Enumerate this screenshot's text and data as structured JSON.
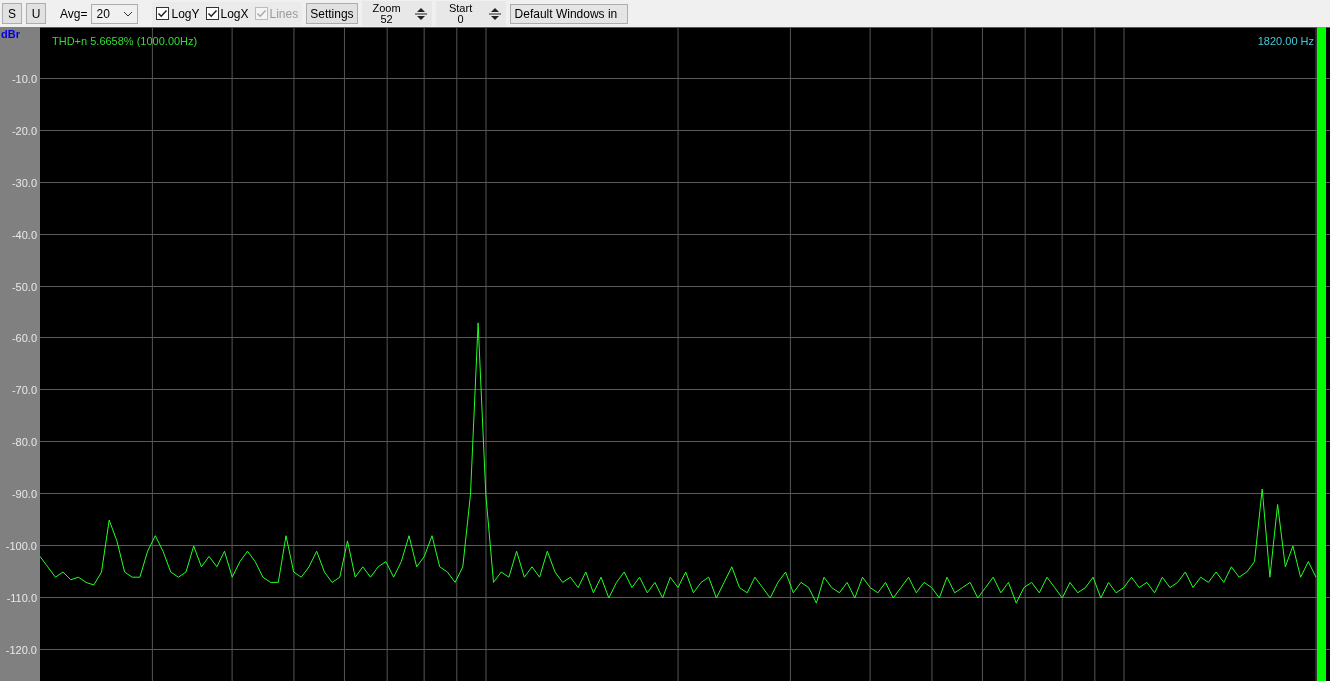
{
  "toolbar": {
    "buttons": [
      "S",
      "U"
    ],
    "avg": {
      "label": "Avg=",
      "value": "20"
    },
    "checkboxes": [
      {
        "label": "LogY",
        "checked": true,
        "disabled": false
      },
      {
        "label": "LogX",
        "checked": true,
        "disabled": false
      },
      {
        "label": "Lines",
        "checked": true,
        "disabled": true
      }
    ],
    "settings_button": "Settings",
    "spinners": [
      {
        "label": "Zoom",
        "value": "52"
      },
      {
        "label": "Start",
        "value": "0"
      }
    ],
    "device_select": {
      "value": "Default Windows in"
    }
  },
  "plot": {
    "y_unit": "dBr",
    "readout": "THD+n 5.6658% (1000.00Hz)",
    "cursor_frequency": "1820.00 Hz",
    "chart_data": {
      "type": "line",
      "grid": true,
      "ylim": [
        -126,
        0
      ],
      "yticks": [
        {
          "value": -10,
          "label": "-10.0"
        },
        {
          "value": -20,
          "label": "-20.0"
        },
        {
          "value": -30,
          "label": "-30.0"
        },
        {
          "value": -40,
          "label": "-40.0"
        },
        {
          "value": -50,
          "label": "-50.0"
        },
        {
          "value": -60,
          "label": "-60.0"
        },
        {
          "value": -70,
          "label": "-70.0"
        },
        {
          "value": -80,
          "label": "-80.0"
        },
        {
          "value": -90,
          "label": "-90.0"
        },
        {
          "value": -100,
          "label": "-100.0"
        },
        {
          "value": -110,
          "label": "-110.0"
        },
        {
          "value": -120,
          "label": "-120.0"
        }
      ],
      "categories": [
        null,
        null,
        null,
        null,
        null,
        null,
        null,
        null,
        null,
        null,
        null,
        null,
        null,
        null,
        null,
        null,
        null,
        null,
        null,
        null,
        null,
        null,
        null,
        null,
        null,
        null,
        null,
        null,
        null,
        null,
        null,
        null,
        null,
        null,
        null,
        null,
        null,
        null,
        null,
        null,
        null,
        null,
        null,
        null,
        null,
        null,
        null,
        null,
        null,
        null,
        null,
        null,
        null,
        null,
        null,
        null,
        null,
        null,
        null,
        null,
        null,
        null,
        null,
        null,
        null,
        null,
        null,
        null,
        null,
        null,
        null,
        null,
        null,
        null,
        null,
        null,
        null,
        null,
        null,
        null,
        null,
        null,
        null,
        null,
        null,
        null,
        null,
        null,
        null,
        null,
        null,
        null,
        null,
        null,
        null,
        null,
        null,
        null,
        null,
        null,
        null,
        null,
        null,
        null,
        null,
        null,
        null,
        null,
        null,
        null,
        null,
        null,
        null,
        null,
        null,
        null,
        null,
        null,
        null,
        null,
        null,
        null,
        null,
        null,
        null,
        null,
        null,
        null,
        null,
        null,
        null,
        null,
        null,
        null,
        null,
        null,
        null,
        null,
        null,
        null,
        null,
        null,
        null,
        null,
        null,
        null,
        null,
        null,
        null,
        null,
        null,
        null,
        null,
        null,
        null,
        null,
        null,
        null,
        null,
        null,
        null,
        null,
        null,
        null,
        null,
        null,
        null
      ],
      "series": [
        {
          "color": "#22ff22",
          "values": [
            -102,
            -104,
            -106,
            -105,
            -106.5,
            -106,
            -107,
            -107.5,
            -105,
            -95,
            -99,
            -105,
            -106,
            -106,
            -101,
            -98,
            -101,
            -105,
            -106,
            -105,
            -100,
            -104,
            -102,
            -104,
            -101,
            -106,
            -103,
            -101,
            -103,
            -106,
            -107,
            -107,
            -98,
            -105,
            -106,
            -104,
            -101,
            -105,
            -107,
            -106,
            -99,
            -106,
            -104,
            -106,
            -104,
            -103,
            -106,
            -103,
            -98,
            -104,
            -102,
            -98,
            -104,
            -105,
            -107,
            -104,
            -90,
            -57,
            -90,
            -107,
            -105,
            -106,
            -101,
            -106,
            -104,
            -106,
            -101,
            -105,
            -107,
            -106,
            -108,
            -105,
            -109,
            -106,
            -110,
            -107,
            -105,
            -108,
            -106,
            -109,
            -107,
            -110,
            -106,
            -108,
            -105,
            -109,
            -107,
            -106,
            -110,
            -107,
            -104,
            -108,
            -109,
            -106,
            -108,
            -110,
            -107,
            -105,
            -109,
            -107,
            -108,
            -111,
            -106,
            -108,
            -109,
            -107,
            -110,
            -106,
            -108,
            -109,
            -107,
            -110,
            -108,
            -106,
            -109,
            -107,
            -108,
            -110,
            -106,
            -109,
            -108,
            -107,
            -110,
            -108,
            -106,
            -109,
            -107,
            -111,
            -108,
            -107,
            -109,
            -106,
            -108,
            -110,
            -107,
            -109,
            -108,
            -106,
            -110,
            -107,
            -109,
            -108,
            -106,
            -108,
            -107,
            -109,
            -106,
            -108,
            -107,
            -105,
            -108,
            -106,
            -107,
            -105,
            -107,
            -104,
            -106,
            -105,
            -103,
            -89,
            -106,
            -92,
            -104,
            -100,
            -106,
            -103,
            -106
          ]
        }
      ]
    }
  }
}
